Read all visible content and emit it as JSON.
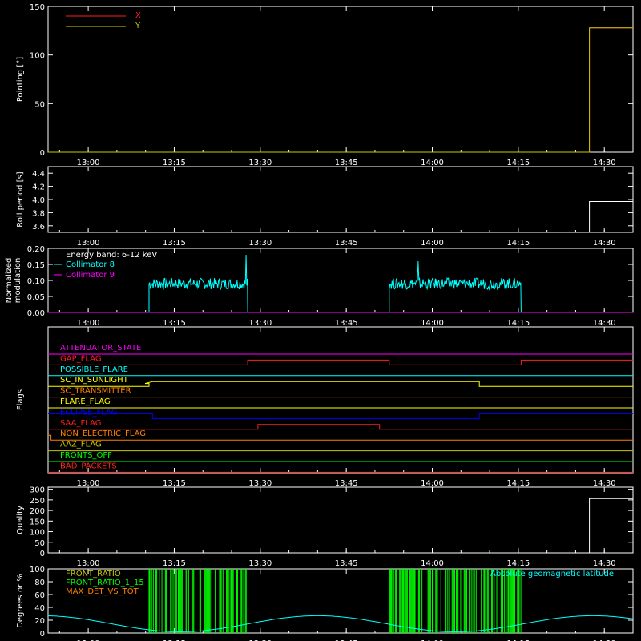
{
  "colors": {
    "bg": "#000000",
    "axis": "#ffffff",
    "x": "#ff2020",
    "y": "#c8c800",
    "c8": "#00ffff",
    "c9": "#ff00ff",
    "green": "#00ff00",
    "orange": "#ff8000",
    "cyan": "#00ffff"
  },
  "x_ticks": [
    "13:00",
    "13:15",
    "13:30",
    "13:45",
    "14:00",
    "14:15",
    "14:30"
  ],
  "x_tick_minutes": [
    780,
    795,
    810,
    825,
    840,
    855,
    870
  ],
  "x_range": [
    773,
    875
  ],
  "chart_data": [
    {
      "type": "line",
      "ylabel": "Pointing [°]",
      "ylim": [
        0,
        150
      ],
      "yticks": [
        "0",
        "50",
        "100",
        "150"
      ],
      "ytick_values": [
        0,
        50,
        100,
        150
      ],
      "legend": [
        "X",
        "Y"
      ],
      "series": [
        {
          "name": "X",
          "x": [
            773,
            867.4,
            867.4,
            875
          ],
          "y": [
            0,
            0,
            128,
            128
          ]
        },
        {
          "name": "Y",
          "x": [
            773,
            867.4,
            867.4,
            875
          ],
          "y": [
            0,
            0,
            128,
            128
          ]
        }
      ]
    },
    {
      "type": "line",
      "ylabel": "Roll period [s]",
      "ylim": [
        3.5,
        4.5
      ],
      "yticks": [
        "3.6",
        "3.8",
        "4.0",
        "4.2",
        "4.4"
      ],
      "ytick_values": [
        3.6,
        3.8,
        4.0,
        4.2,
        4.4
      ],
      "series": [
        {
          "x": [
            867.4,
            867.4,
            875
          ],
          "y": [
            3.5,
            3.97,
            3.97
          ]
        }
      ]
    },
    {
      "type": "line",
      "ylabel": "Normalized modulation",
      "ylim": [
        0,
        0.2
      ],
      "yticks": [
        "0.00",
        "0.05",
        "0.10",
        "0.15",
        "0.20"
      ],
      "ytick_values": [
        0,
        0.05,
        0.1,
        0.15,
        0.2
      ],
      "legend": [
        "Energy band: 6-12 keV",
        "Collimator 8",
        "Collimator 9"
      ],
      "series": [
        {
          "name": "Collimator 8",
          "segments": [
            {
              "start": 790.6,
              "end": 807.8,
              "level": 0.09,
              "spike": 0.18
            },
            {
              "start": 832.5,
              "end": 855.5,
              "level": 0.09,
              "spike": 0.16
            }
          ]
        },
        {
          "name": "Collimator 9",
          "level": 0
        }
      ]
    },
    {
      "type": "line",
      "ylabel": "Flags",
      "flags": [
        {
          "name": "ATTENUATOR_STATE",
          "color": "#ff00ff",
          "x": [
            773,
            875
          ],
          "v": [
            0,
            0
          ]
        },
        {
          "name": "GAP_FLAG",
          "color": "#ff2020",
          "x": [
            773,
            807.8,
            807.8,
            832.5,
            832.5,
            855.5,
            855.5,
            875
          ],
          "v": [
            0,
            0,
            1,
            1,
            0,
            0,
            1,
            1
          ]
        },
        {
          "name": "POSSIBLE_FLARE",
          "color": "#00ffff",
          "x": [
            773,
            875
          ],
          "v": [
            0,
            0
          ]
        },
        {
          "name": "SC_IN_SUNLIGHT",
          "color": "#ffff00",
          "x": [
            773,
            790.6,
            790.6,
            789.9,
            791.2,
            848.2,
            848.2,
            875
          ],
          "v": [
            0,
            0,
            0.6,
            0.6,
            1,
            1,
            0,
            0
          ]
        },
        {
          "name": "SC_TRANSMITTER",
          "color": "#ff8000",
          "x": [
            773,
            875
          ],
          "v": [
            0,
            0
          ]
        },
        {
          "name": "FLARE_FLAG",
          "color": "#ffff00",
          "x": [
            773,
            875
          ],
          "v": [
            0,
            0
          ]
        },
        {
          "name": "ECLIPSE_FLAG",
          "color": "#0000ff",
          "x": [
            773,
            791.2,
            791.2,
            848.2,
            848.2,
            875
          ],
          "v": [
            1,
            1,
            0,
            0,
            1,
            1
          ]
        },
        {
          "name": "SAA_FLAG",
          "color": "#ff2020",
          "x": [
            773,
            809.6,
            809.6,
            830.8,
            830.8,
            875
          ],
          "v": [
            0,
            0,
            1,
            1,
            0,
            0
          ]
        },
        {
          "name": "NON_ELECTRIC_FLAG",
          "color": "#ff8000",
          "x": [
            773,
            773.5,
            773.5,
            875
          ],
          "v": [
            1,
            1,
            0,
            0
          ]
        },
        {
          "name": "AAZ_FLAG",
          "color": "#c8c800",
          "x": [
            773,
            875
          ],
          "v": [
            0,
            0
          ]
        },
        {
          "name": "FRONTS_OFF",
          "color": "#00ff00",
          "x": [
            773,
            875
          ],
          "v": [
            0,
            0
          ]
        },
        {
          "name": "BAD_PACKETS",
          "color": "#ff2020",
          "x": [
            773,
            875
          ],
          "v": [
            0,
            0
          ]
        }
      ]
    },
    {
      "type": "line",
      "ylabel": "Quality",
      "ylim": [
        0,
        310
      ],
      "yticks": [
        "0",
        "50",
        "100",
        "150",
        "200",
        "250",
        "300"
      ],
      "ytick_values": [
        0,
        50,
        100,
        150,
        200,
        250,
        300
      ],
      "series": [
        {
          "x": [
            867.4,
            867.4,
            875
          ],
          "y": [
            0,
            256,
            256
          ]
        }
      ]
    },
    {
      "type": "line",
      "ylabel": "Degrees or %",
      "ylim": [
        0,
        100
      ],
      "yticks": [
        "0",
        "20",
        "40",
        "60",
        "80",
        "100"
      ],
      "ytick_values": [
        0,
        20,
        40,
        60,
        80,
        100
      ],
      "legend": [
        "FRONT_RATIO",
        "FRONT_RATIO_1_15",
        "MAX_DET_VS_TOT"
      ],
      "annotation": "Absolute geomagnetic latitude",
      "green_bands": [
        [
          790.6,
          807.8
        ],
        [
          832.5,
          855.5
        ]
      ],
      "latitude_curve": {
        "period_minutes": 48,
        "min": 2,
        "max": 27,
        "phase_peak": 820
      }
    }
  ]
}
